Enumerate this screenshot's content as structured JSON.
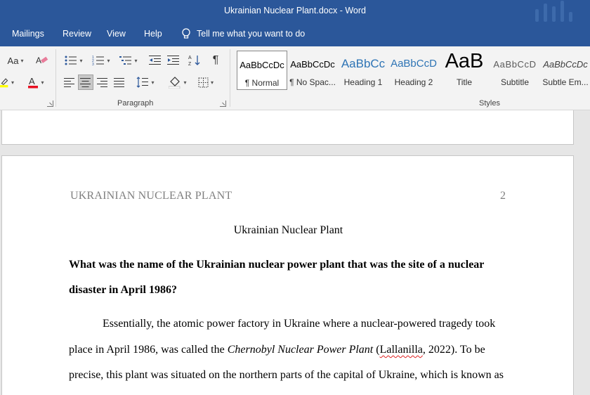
{
  "window": {
    "title": "Ukrainian Nuclear Plant.docx  -  Word"
  },
  "menu": {
    "items": [
      "Mailings",
      "Review",
      "View",
      "Help"
    ],
    "tell_me": "Tell me what you want to do"
  },
  "ribbon": {
    "font_group": {
      "font_size_button": "Aa"
    },
    "paragraph_group": {
      "label": "Paragraph",
      "pilcrow": "¶"
    },
    "styles_group": {
      "label": "Styles",
      "tiles": [
        {
          "sample": "AaBbCcDc",
          "name": "¶ Normal",
          "active": true
        },
        {
          "sample": "AaBbCcDc",
          "name": "¶ No Spac..."
        },
        {
          "sample": "AaBbCc",
          "name": "Heading 1",
          "color": "#2e74b5"
        },
        {
          "sample": "AaBbCcD",
          "name": "Heading 2",
          "color": "#2e74b5"
        },
        {
          "sample": "AaB",
          "name": "Title"
        },
        {
          "sample": "AaBbCcD",
          "name": "Subtitle",
          "color": "#5a5a5a"
        },
        {
          "sample": "AaBbCcDc",
          "name": "Subtle Em..."
        }
      ]
    },
    "colors": {
      "highlight": "#ffff00",
      "font_color": "#e81123"
    }
  },
  "document": {
    "header_title": "UKRAINIAN NUCLEAR PLANT",
    "page_number": "2",
    "title": "Ukrainian Nuclear Plant",
    "question_line1": "What was the name of the Ukrainian nuclear power plant that was the site of a nuclear",
    "question_line2": "disaster in April 1986?",
    "para_line1": "Essentially, the atomic power factory in Ukraine where a nuclear-powered tragedy took",
    "para_line2_pre": "place in April 1986, was called the ",
    "para_line2_italic": "Chernobyl Nuclear Power Plant",
    "para_line2_mid": " (",
    "para_line2_cite": "Lallanilla",
    "para_line2_post": ", 2022). To be",
    "para_line3": "precise, this plant was situated on the northern parts of the capital of Ukraine, which is known as"
  }
}
